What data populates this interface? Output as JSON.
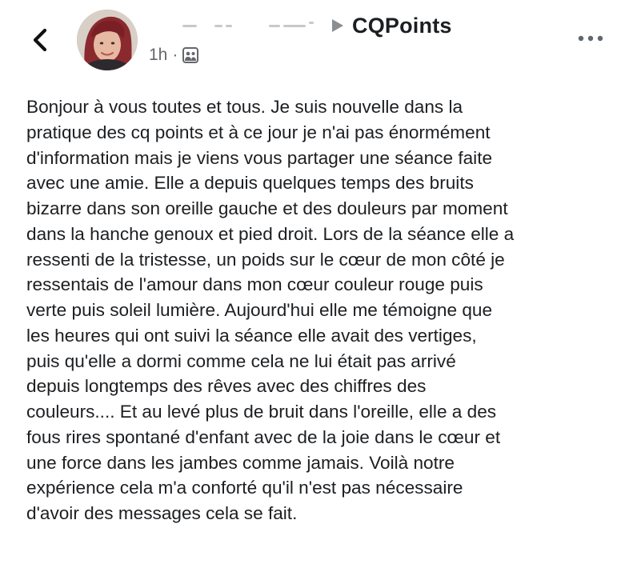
{
  "header": {
    "back_icon": "back-arrow-icon",
    "author_name_obscured": true,
    "arrow_icon": "right-triangle-icon",
    "group_name": "CQPoints",
    "timestamp": "1h",
    "separator": "·",
    "audience_icon": "group-audience-icon",
    "more_icon": "more-options-icon"
  },
  "post": {
    "text": "Bonjour à vous toutes et tous. Je suis nouvelle dans la\npratique des cq points et à ce jour je n'ai pas énormément\nd'information mais je viens vous partager une séance faite\navec une amie. Elle a depuis quelques temps des bruits\nbizarre dans son oreille gauche et des douleurs par moment\ndans la hanche genoux et pied droit. Lors de la séance elle a\nressenti de la tristesse, un poids sur le cœur de mon côté je\nressentais de l'amour dans mon cœur couleur rouge puis\nverte puis soleil lumière. Aujourd'hui elle me témoigne que\nles heures qui ont suivi la séance elle avait des vertiges,\npuis qu'elle a dormi comme cela ne lui était pas arrivé\ndepuis longtemps des rêves avec des chiffres des\ncouleurs.... Et au levé plus de bruit dans l'oreille, elle a des\nfous rires spontané d'enfant avec de la joie dans le cœur et\nune force dans les jambes comme jamais. Voilà notre\nexpérience cela m'a conforté qu'il n'est pas nécessaire\nd'avoir des messages cela se fait."
  }
}
